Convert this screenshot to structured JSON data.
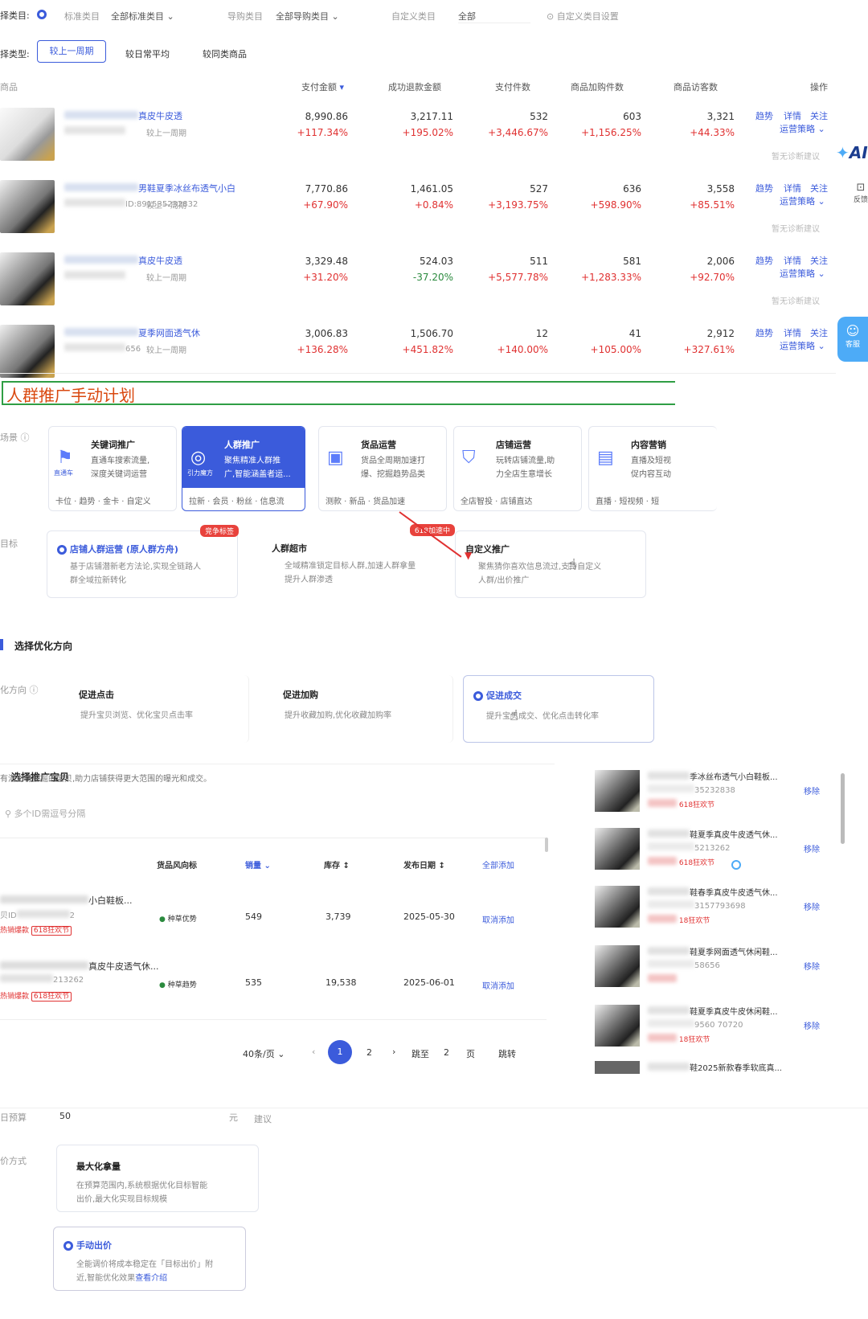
{
  "filter": {
    "label": "择类目:",
    "std_label": "标准类目",
    "std_value": "全部标准类目",
    "guide_label": "导购类目",
    "guide_value": "全部导购类目",
    "custom_label": "自定义类目",
    "custom_value": "全部",
    "custom_setting": "自定义类目设置"
  },
  "compare": {
    "label": "择类型:",
    "options": [
      "较上一周期",
      "较日常平均",
      "较同类商品"
    ]
  },
  "table": {
    "headers": [
      "商品",
      "支付金额",
      "成功退款金额",
      "支付件数",
      "商品加购件数",
      "商品访客数",
      "操作"
    ],
    "rows": [
      {
        "name": "真皮牛皮透",
        "id": "",
        "period": "较上一周期",
        "pay": "8,990.86",
        "pay_d": "+117.34%",
        "refund": "3,217.11",
        "refund_d": "+195.02%",
        "qty": "532",
        "qty_d": "+3,446.67%",
        "cart": "603",
        "cart_d": "+1,156.25%",
        "uv": "3,321",
        "uv_d": "+44.33%",
        "ops": [
          "趋势",
          "详情",
          "关注"
        ],
        "strategy": "运营策略",
        "advice": "暂无诊断建议"
      },
      {
        "name": "男鞋夏季冰丝布透气小白",
        "id": "ID:891535232832",
        "period": "较上一周期",
        "pay": "7,770.86",
        "pay_d": "+67.90%",
        "refund": "1,461.05",
        "refund_d": "+0.84%",
        "qty": "527",
        "qty_d": "+3,193.75%",
        "cart": "636",
        "cart_d": "+598.90%",
        "uv": "3,558",
        "uv_d": "+85.51%",
        "ops": [
          "趋势",
          "详情",
          "关注"
        ],
        "strategy": "运营策略",
        "advice": "暂无诊断建议"
      },
      {
        "name": "真皮牛皮透",
        "id": "",
        "period": "较上一周期",
        "pay": "3,329.48",
        "pay_d": "+31.20%",
        "refund": "524.03",
        "refund_d": "-37.20%",
        "qty": "511",
        "qty_d": "+5,577.78%",
        "cart": "581",
        "cart_d": "+1,283.33%",
        "uv": "2,006",
        "uv_d": "+92.70%",
        "ops": [
          "趋势",
          "详情",
          "关注"
        ],
        "strategy": "运营策略",
        "advice": "暂无诊断建议"
      },
      {
        "name": "夏季网面透气休",
        "id": "656",
        "period": "较上一周期",
        "pay": "3,006.83",
        "pay_d": "+136.28%",
        "refund": "1,506.70",
        "refund_d": "+451.82%",
        "qty": "12",
        "qty_d": "+140.00%",
        "cart": "41",
        "cart_d": "+105.00%",
        "uv": "2,912",
        "uv_d": "+327.61%",
        "ops": [
          "趋势",
          "详情",
          "关注"
        ],
        "strategy": "运营策略",
        "advice": ""
      }
    ]
  },
  "side": {
    "ai": "AI",
    "feedback": "反馈",
    "service": "客服"
  },
  "plan_title": "人群推广手动计划",
  "scene": {
    "label": "场景",
    "cards": [
      {
        "title": "关键词推广",
        "icon_text": "直通车",
        "desc1": "直通车搜索流量,",
        "desc2": "深度关键词运营",
        "foot": "卡位 · 趋势 · 金卡 · 自定义"
      },
      {
        "title": "人群推广",
        "icon_text": "引力魔方",
        "desc1": "聚焦精准人群推",
        "desc2": "广,智能涵盖者运...",
        "foot": "拉新 · 会员 · 粉丝 · 信息流"
      },
      {
        "title": "货品运营",
        "desc1": "货品全周期加速打",
        "desc2": "爆、挖掘趋势品类",
        "foot": "测款 · 新品 · 货品加速"
      },
      {
        "title": "店铺运营",
        "desc1": "玩转店铺流量,助",
        "desc2": "力全店生意增长",
        "foot": "全店智投 · 店铺直达"
      },
      {
        "title": "内容营销",
        "desc1": "直播及短视",
        "desc2": "促内容互动",
        "foot": "直播 · 短视频 · 短"
      }
    ]
  },
  "goal": {
    "label": "目标",
    "cards": [
      {
        "title": "店铺人群运营 (原人群方舟)",
        "badge": "竞争标签",
        "desc1": "基于店铺潜新老方法论,实现全链路人",
        "desc2": "群全域拉新转化"
      },
      {
        "title": "人群超市",
        "badge": "618加速中",
        "desc1": "全域精准锁定目标人群,加速人群拿量",
        "desc2": "提升人群渗透"
      },
      {
        "title": "自定义推广",
        "desc1": "聚焦猜你喜欢信息流过,支持自定义",
        "desc2": "人群/出价推广"
      }
    ]
  },
  "opt": {
    "section": "选择优化方向",
    "label": "化方向",
    "cards": [
      {
        "title": "促进点击",
        "desc": "提升宝贝浏览、优化宝贝点击率"
      },
      {
        "title": "促进加购",
        "desc": "提升收藏加购,优化收藏加购率"
      },
      {
        "title": "促进成交",
        "desc": "提升宝贝成交、优化点击转化率"
      }
    ]
  },
  "goods": {
    "section": "选择推广宝贝",
    "hint": "有潜力待挖掘的宝贝,助力店铺获得更大范围的曝光和成交。",
    "search_placeholder": "多个ID需逗号分隔",
    "headers": [
      "货品风向标",
      "销量",
      "库存",
      "发布日期",
      "全部添加"
    ],
    "rows": [
      {
        "name": "小白鞋板...",
        "id_prefix": "贝ID",
        "id_suffix": "2",
        "tag1": "热销爆款",
        "tag2": "618狂欢节",
        "trend": "种草优势",
        "sales": "549",
        "stock": "3,739",
        "date": "2025-05-30",
        "action": "取消添加"
      },
      {
        "name": "真皮牛皮透气休...",
        "id_prefix": "",
        "id_suffix": "213262",
        "tag1": "热销爆款",
        "tag2": "618狂欢节",
        "trend": "种草趋势",
        "sales": "535",
        "stock": "19,538",
        "date": "2025-06-01",
        "action": "取消添加"
      }
    ],
    "pager": {
      "size": "40条/页",
      "pages": [
        "1",
        "2"
      ],
      "jump_label": "跳至",
      "jump_value": "2",
      "page_unit": "页",
      "jump_btn": "跳转"
    }
  },
  "selected": {
    "remove": "移除",
    "items": [
      {
        "name": "季冰丝布透气小白鞋板...",
        "id": "35232838",
        "tag": "618狂欢节"
      },
      {
        "name": "鞋夏季真皮牛皮透气休...",
        "id": "5213262",
        "tag": "618狂欢节"
      },
      {
        "name": "鞋春季真皮牛皮透气休...",
        "id": "3157793698",
        "tag": "18狂欢节"
      },
      {
        "name": "鞋夏季网面透气休闲鞋...",
        "id": "58656",
        "tag": ""
      },
      {
        "name": "鞋夏季真皮牛皮休闲鞋...",
        "id": "9560  70720",
        "tag": "18狂欢节"
      },
      {
        "name": "鞋2025新款春季软底真...",
        "id": "",
        "tag": ""
      }
    ]
  },
  "budget": {
    "label": "日预算",
    "value": "50",
    "unit": "元",
    "suggest": "建议"
  },
  "bid": {
    "label": "价方式",
    "cards": [
      {
        "title": "最大化拿量",
        "desc1": "在预算范围内,系统根据优化目标智能",
        "desc2": "出价,最大化实现目标规模"
      },
      {
        "title": "手动出价",
        "desc1": "全能调价将成本稳定在「目标出价」附",
        "desc2": "近,智能优化效果",
        "link": "查看介绍"
      }
    ]
  }
}
